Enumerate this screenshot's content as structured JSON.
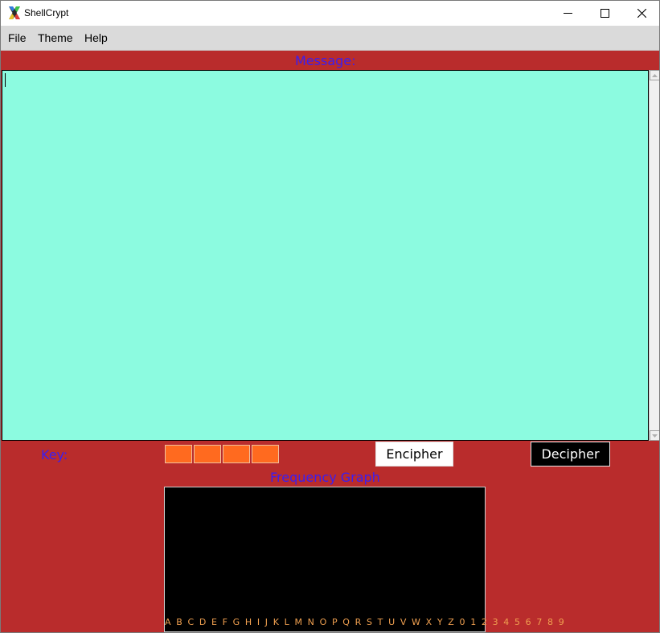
{
  "window": {
    "title": "ShellCrypt",
    "minimize_icon": "minimize-icon",
    "maximize_icon": "maximize-icon",
    "close_icon": "close-icon"
  },
  "menu": {
    "items": [
      "File",
      "Theme",
      "Help"
    ]
  },
  "message": {
    "label": "Message:",
    "value": ""
  },
  "key": {
    "label": "Key:",
    "values": [
      "",
      "",
      "",
      ""
    ]
  },
  "buttons": {
    "encipher": "Encipher",
    "decipher": "Decipher"
  },
  "frequency_graph": {
    "title": "Frequency Graph",
    "axis_labels": "A B C D E F G H I J K L M N O P Q R S T U V W X Y Z 0 1 2 3 4 5 6 7 8 9"
  },
  "colors": {
    "background": "#b92c2c",
    "label_text": "#3b1ef0",
    "message_area": "#8cfbe0",
    "key_boxes": "#ff6a1f",
    "graph_background": "#000000",
    "graph_axis_text": "#f0a050"
  }
}
